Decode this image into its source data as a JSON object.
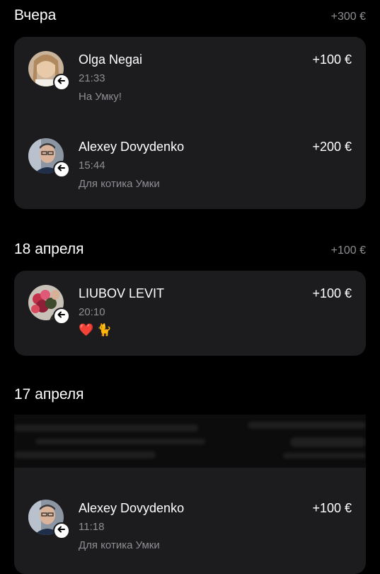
{
  "sections": [
    {
      "title": "Вчера",
      "total": "+300 €",
      "transactions": [
        {
          "name": "Olga Negai",
          "time": "21:33",
          "note": "На Умку!",
          "amount": "+100 €",
          "avatar": "avatar-woman"
        },
        {
          "name": "Alexey Dovydenko",
          "time": "15:44",
          "note": "Для котика Умки",
          "amount": "+200 €",
          "avatar": "avatar-man"
        }
      ]
    },
    {
      "title": "18 апреля",
      "total": "+100 €",
      "transactions": [
        {
          "name": "LIUBOV LEVIT",
          "time": "20:10",
          "note": "❤️ 🐈",
          "amount": "+100 €",
          "avatar": "avatar-flowers"
        }
      ]
    },
    {
      "title": "17 апреля",
      "total": "",
      "transactions": [
        {
          "name": "Alexey Dovydenko",
          "time": "11:18",
          "note": "Для котика Умки",
          "amount": "+100 €",
          "avatar": "avatar-man"
        }
      ]
    }
  ],
  "incoming_icon": "arrow-left-icon",
  "colors": {
    "background": "#000000",
    "card": "#1c1c1e",
    "secondary_text": "#8e8e93"
  }
}
